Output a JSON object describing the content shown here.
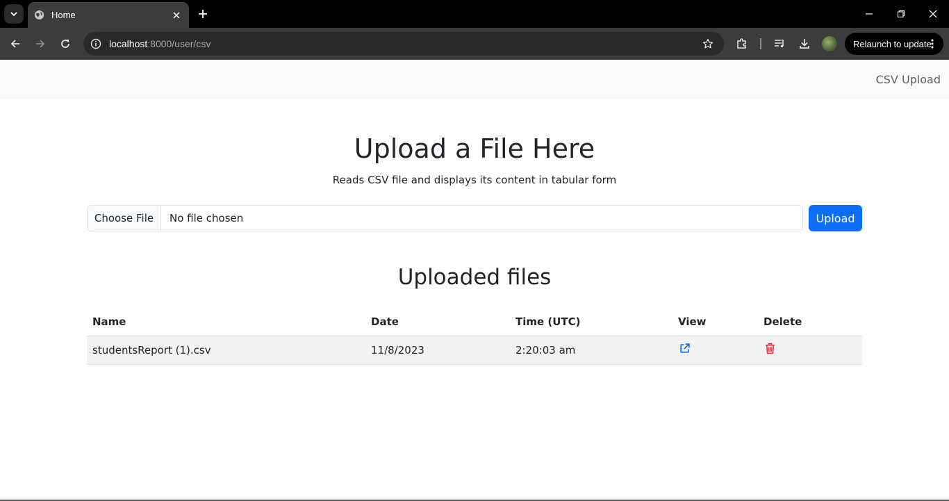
{
  "browser": {
    "tab": {
      "title": "Home"
    },
    "url": {
      "host": "localhost",
      "path": ":8000/user/csv"
    },
    "relaunch_label": "Relaunch to update"
  },
  "navbar": {
    "link": "CSV Upload"
  },
  "hero": {
    "title": "Upload a File Here",
    "subtitle": "Reads CSV file and displays its content in tabular form"
  },
  "upload_form": {
    "choose_label": "Choose File",
    "file_status": "No file chosen",
    "upload_label": "Upload"
  },
  "files": {
    "title": "Uploaded files",
    "columns": [
      "Name",
      "Date",
      "Time (UTC)",
      "View",
      "Delete"
    ],
    "rows": [
      {
        "name": "studentsReport (1).csv",
        "date": "11/8/2023",
        "time": "2:20:03 am"
      }
    ]
  },
  "colors": {
    "primary": "#0d6efd",
    "danger": "#dc3545",
    "navbar_bg": "#f8f9fa",
    "row_stripe": "#f2f2f2"
  }
}
